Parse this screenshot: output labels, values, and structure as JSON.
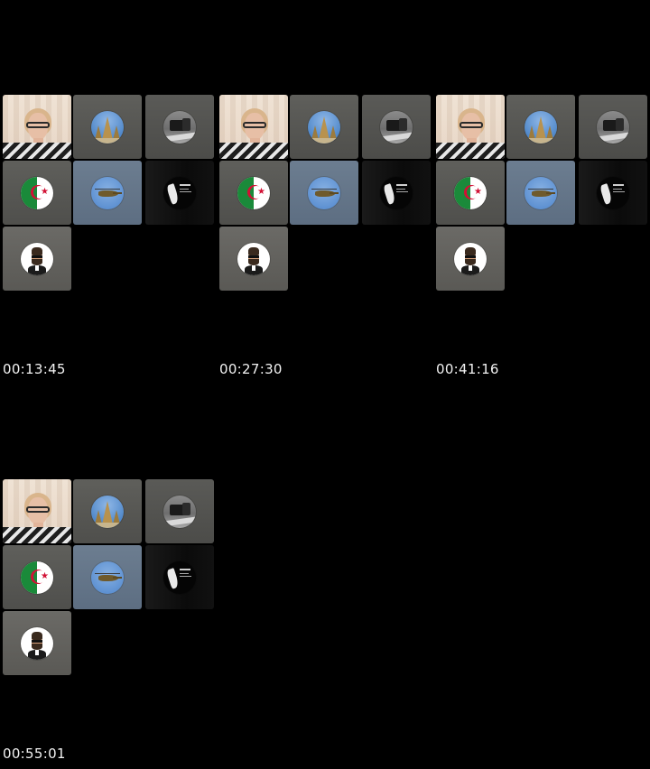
{
  "frames": [
    {
      "timestamp": "00:13:45"
    },
    {
      "timestamp": "00:27:30"
    },
    {
      "timestamp": "00:41:16"
    },
    {
      "timestamp": "00:55:01"
    }
  ],
  "participants": [
    {
      "avatar": "woman-selfie-video"
    },
    {
      "avatar": "landmark-photo-avatar"
    },
    {
      "avatar": "truck-photo-avatar"
    },
    {
      "avatar": "algeria-flag-avatar"
    },
    {
      "avatar": "helicopter-photo-avatar"
    },
    {
      "avatar": "black-logo-avatar"
    },
    {
      "avatar": "cartoon-man-avatar"
    }
  ],
  "colors": {
    "background": "#000000",
    "timestamp_text": "#f2f2f2",
    "tile_gray": "#575753",
    "tile_blue": "#657689",
    "flag_green": "#1a8a3a",
    "flag_red": "#d21034"
  }
}
